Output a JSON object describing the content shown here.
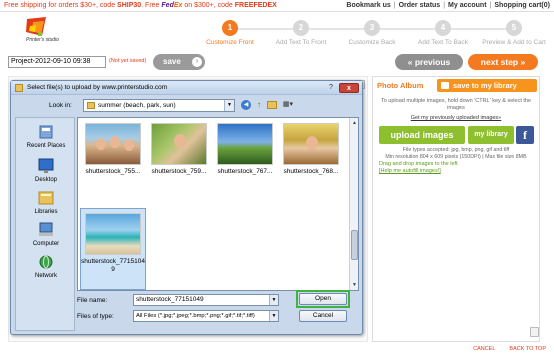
{
  "promo": {
    "prefix": "Free shipping for orders $30+, code ",
    "code1": "SHIP30",
    "mid": ". Free ",
    "fedex_fed": "Fed",
    "fedex_ex": "Ex",
    "suffix": " on $300+, code ",
    "code2": "FREEFEDEX"
  },
  "toplinks": [
    "Bookmark us",
    "Order status",
    "My account",
    "Shopping cart(0)"
  ],
  "logo_text": "Printer's studio",
  "steps": [
    {
      "num": "1",
      "label": "Customize Front"
    },
    {
      "num": "2",
      "label": "Add Text To Front"
    },
    {
      "num": "3",
      "label": "Customize Back"
    },
    {
      "num": "4",
      "label": "Add Text To Back"
    },
    {
      "num": "5",
      "label": "Preview & Add to Cart"
    }
  ],
  "active_step": 1,
  "project": {
    "name": "Project-2012-09-10 09:38",
    "status": "(Not yet saved)",
    "save": "save",
    "save_arrow": "›"
  },
  "nav": {
    "previous": "« previous",
    "next": "next step »"
  },
  "album": {
    "title": "Photo Album",
    "save_to_library": "save to my library",
    "note": "To upload multiple images, hold down 'CTRL' key & select the images",
    "prev_link": "Get my previously uploaded images»",
    "upload": "upload images",
    "my_library": "my library",
    "facebook": "f",
    "file_types": "File types accepted: jpg, bmp, png, gif and tiff",
    "resolution": "Min resolution 804 x 609 pixels (150DPI) | Max file size 8MB",
    "drag_note": "Drag and drop images to the left",
    "help": "[Help me autofill images!]"
  },
  "bottom_links": [
    "CANCEL",
    "BACK TO TOP"
  ],
  "side_button": "view",
  "dialog": {
    "title": "Select file(s) to upload by www.printerstudio.com",
    "help": "?",
    "close": "x",
    "look_in_label": "Look in:",
    "look_in_value": "summer (beach, park, sun)",
    "places": [
      "Recent Places",
      "Desktop",
      "Libraries",
      "Computer",
      "Network"
    ],
    "files": [
      {
        "name": "shutterstock_755..."
      },
      {
        "name": "shutterstock_759..."
      },
      {
        "name": "shutterstock_767..."
      },
      {
        "name": "shutterstock_768..."
      },
      {
        "name": "shutterstock_77151049",
        "selected": true
      }
    ],
    "file_name_label": "File name:",
    "file_name_value": "shutterstock_77151049",
    "files_of_type_label": "Files of type:",
    "files_of_type_value": "All Files (*.jpg;*.jpeg;*.bmp;*.png;*.gif;*.tif;*.tiff)",
    "open": "Open",
    "cancel": "Cancel"
  },
  "colors": {
    "accent": "#f47a20",
    "green": "#8dbf2e",
    "facebook": "#3b5998",
    "promo_red": "#e23a1a",
    "open_highlight": "#3fb33f"
  }
}
